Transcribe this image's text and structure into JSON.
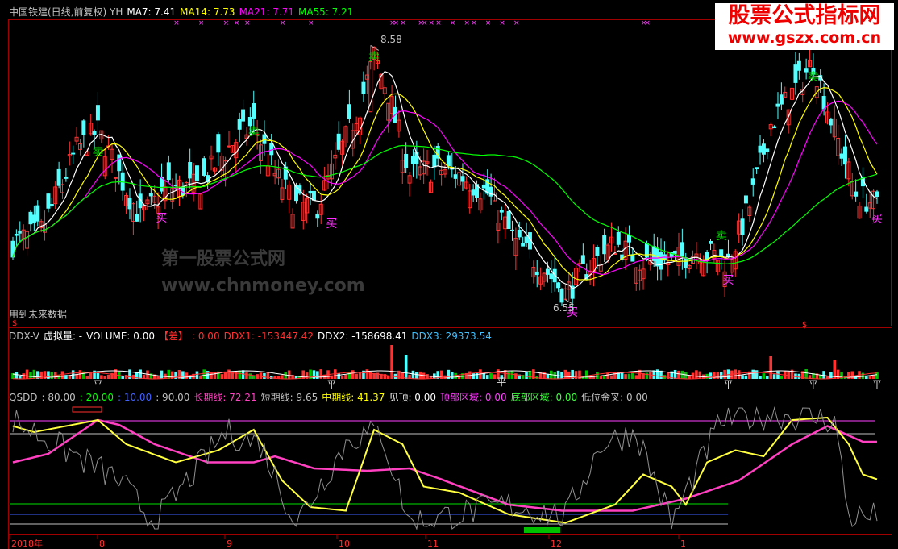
{
  "main": {
    "title": "中国铁建(日线,前复权) YH",
    "ma": [
      {
        "label": "MA7: 7.41",
        "color": "#ffffff"
      },
      {
        "label": "MA14: 7.73",
        "color": "#ffff00"
      },
      {
        "label": "MA21: 7.71",
        "color": "#ff00ff"
      },
      {
        "label": "MA55: 7.21",
        "color": "#00ff00"
      }
    ],
    "high_label": "8.58",
    "low_label": "6.55",
    "note": "用到未来数据",
    "marker": "$",
    "buy": "买",
    "sell": "卖",
    "x_mark": "×"
  },
  "ddx": {
    "labels": [
      {
        "text": "DDX-V",
        "color": "#c0c0c0"
      },
      {
        "text": "虚拟量: -",
        "color": "#ffffff"
      },
      {
        "text": "VOLUME: 0.00",
        "color": "#ffffff"
      },
      {
        "text": "【差】",
        "color": "#ff3030"
      },
      {
        "text": ": 0.00",
        "color": "#ff3030"
      },
      {
        "text": "DDX1: -153447.42",
        "color": "#ff3030"
      },
      {
        "text": "DDX2: -158698.41",
        "color": "#ffffff"
      },
      {
        "text": "DDX3: 29373.54",
        "color": "#40c0ff"
      }
    ],
    "zero_mark": "平"
  },
  "qsdd": {
    "labels": [
      {
        "text": "QSDD",
        "color": "#c0c0c0"
      },
      {
        "text": ": 80.00",
        "color": "#c0c0c0"
      },
      {
        "text": ": 20.00",
        "color": "#00ff00"
      },
      {
        "text": ": 10.00",
        "color": "#4060ff"
      },
      {
        "text": ": 90.00",
        "color": "#c0c0c0"
      },
      {
        "text": "长期线: 72.21",
        "color": "#ff40c0"
      },
      {
        "text": "短期线: 9.65",
        "color": "#c0c0c0"
      },
      {
        "text": "中期线: 41.37",
        "color": "#ffff00"
      },
      {
        "text": "见顶: 0.00",
        "color": "#ffffff"
      },
      {
        "text": "顶部区域: 0.00",
        "color": "#ff40ff"
      },
      {
        "text": "底部区域: 0.00",
        "color": "#40ff40"
      },
      {
        "text": "低位金叉: 0.00",
        "color": "#c0c0c0"
      }
    ]
  },
  "axis": {
    "labels": [
      "2018年",
      "8",
      "9",
      "10",
      "11",
      "12",
      "1"
    ]
  },
  "logo": {
    "line1": "股票公式指标网",
    "line2": "www.gszx.com.cn"
  },
  "watermark": {
    "line1": "第一股票公式网",
    "line2": "www.chnmoney.com"
  },
  "chart_data": {
    "type": "candlestick",
    "series": [
      {
        "name": "MA7",
        "values": [
          7.4,
          7.41
        ]
      },
      {
        "name": "MA14",
        "values": [
          7.75,
          7.73
        ]
      },
      {
        "name": "MA21",
        "values": [
          7.7,
          7.71
        ]
      },
      {
        "name": "MA55",
        "values": [
          7.2,
          7.21
        ]
      }
    ],
    "high": 8.58,
    "low": 6.55,
    "ylim": [
      6.4,
      8.75
    ],
    "sub_indicators": {
      "DDX1": -153447.42,
      "DDX2": -158698.41,
      "DDX3": 29373.54,
      "QSDD_levels": [
        80,
        20,
        10,
        90
      ],
      "long_line": 72.21,
      "short_line": 9.65,
      "mid_line": 41.37
    }
  }
}
